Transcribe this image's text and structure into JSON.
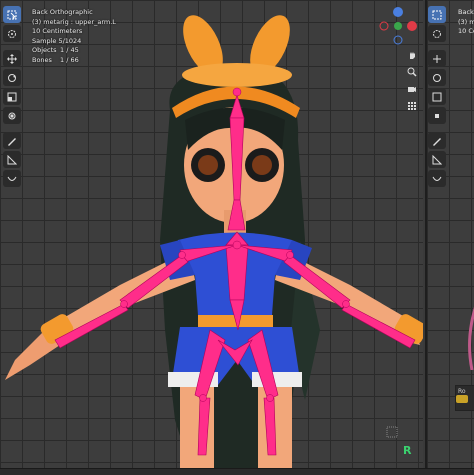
{
  "viewport": {
    "view_name": "Back Orthographic",
    "selection": "(3) metarig : upper_arm.L",
    "scale": "10 Centimeters",
    "sample": "Sample 5/1024",
    "objects_label": "Objects",
    "objects_value": "1 / 45",
    "bones_label": "Bones",
    "bones_value": "1 / 66",
    "axis_label": "R"
  },
  "viewport2": {
    "lines": [
      "Back Ort",
      "(3) meta",
      "10 Centi"
    ],
    "panel_label": "Ro"
  },
  "toolbar": {
    "icons": [
      "select-box-icon",
      "cursor-icon",
      "move-icon",
      "rotate-icon",
      "scale-icon",
      "transform-icon",
      "annotate-icon",
      "measure-icon",
      "roll-icon"
    ]
  },
  "colors": {
    "bone_pink": "#ff2d8a",
    "headband_orange": "#f39a2e",
    "shirt_blue": "#2e4fd4",
    "skin": "#f2a77a",
    "active_tool": "#4772b3"
  }
}
